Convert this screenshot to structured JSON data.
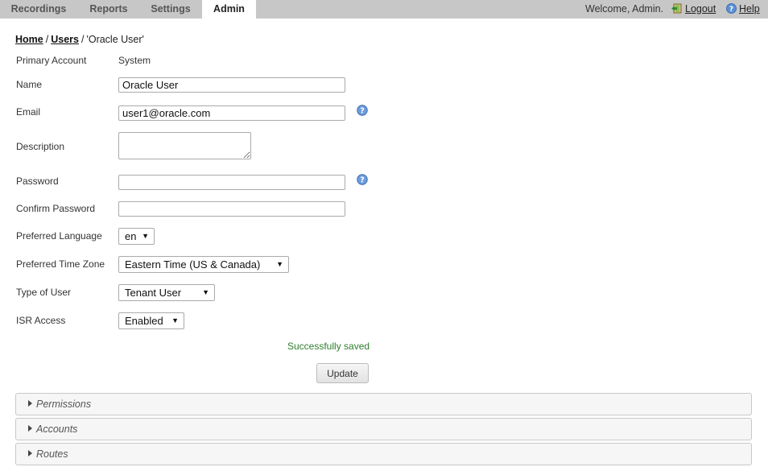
{
  "nav": {
    "tabs": [
      {
        "label": "Recordings"
      },
      {
        "label": "Reports"
      },
      {
        "label": "Settings"
      },
      {
        "label": "Admin",
        "active": true
      }
    ],
    "welcome": "Welcome, Admin.",
    "logout": "Logout",
    "help": "Help",
    "logout_icon": "logout-door-icon",
    "help_icon": "help-question-icon"
  },
  "breadcrumb": {
    "home": "Home",
    "users": "Users",
    "current": "'Oracle User'",
    "separator": "/"
  },
  "form": {
    "primary_account": {
      "label": "Primary Account",
      "value": "System"
    },
    "name": {
      "label": "Name",
      "value": "Oracle User"
    },
    "email": {
      "label": "Email",
      "value": "user1@oracle.com"
    },
    "description": {
      "label": "Description",
      "value": ""
    },
    "password": {
      "label": "Password",
      "value": ""
    },
    "confirm_password": {
      "label": "Confirm Password",
      "value": ""
    },
    "preferred_language": {
      "label": "Preferred Language",
      "value": "en"
    },
    "preferred_time_zone": {
      "label": "Preferred Time Zone",
      "value": "Eastern Time (US & Canada)"
    },
    "type_of_user": {
      "label": "Type of User",
      "value": "Tenant User"
    },
    "isr_access": {
      "label": "ISR Access",
      "value": "Enabled"
    },
    "status_message": "Successfully saved",
    "update_button": "Update"
  },
  "panels": [
    {
      "title": "Permissions"
    },
    {
      "title": "Accounts"
    },
    {
      "title": "Routes"
    }
  ],
  "colors": {
    "topbar": "#c7c7c7",
    "success": "#2e7d2e",
    "help_icon": "#3a74c4"
  }
}
